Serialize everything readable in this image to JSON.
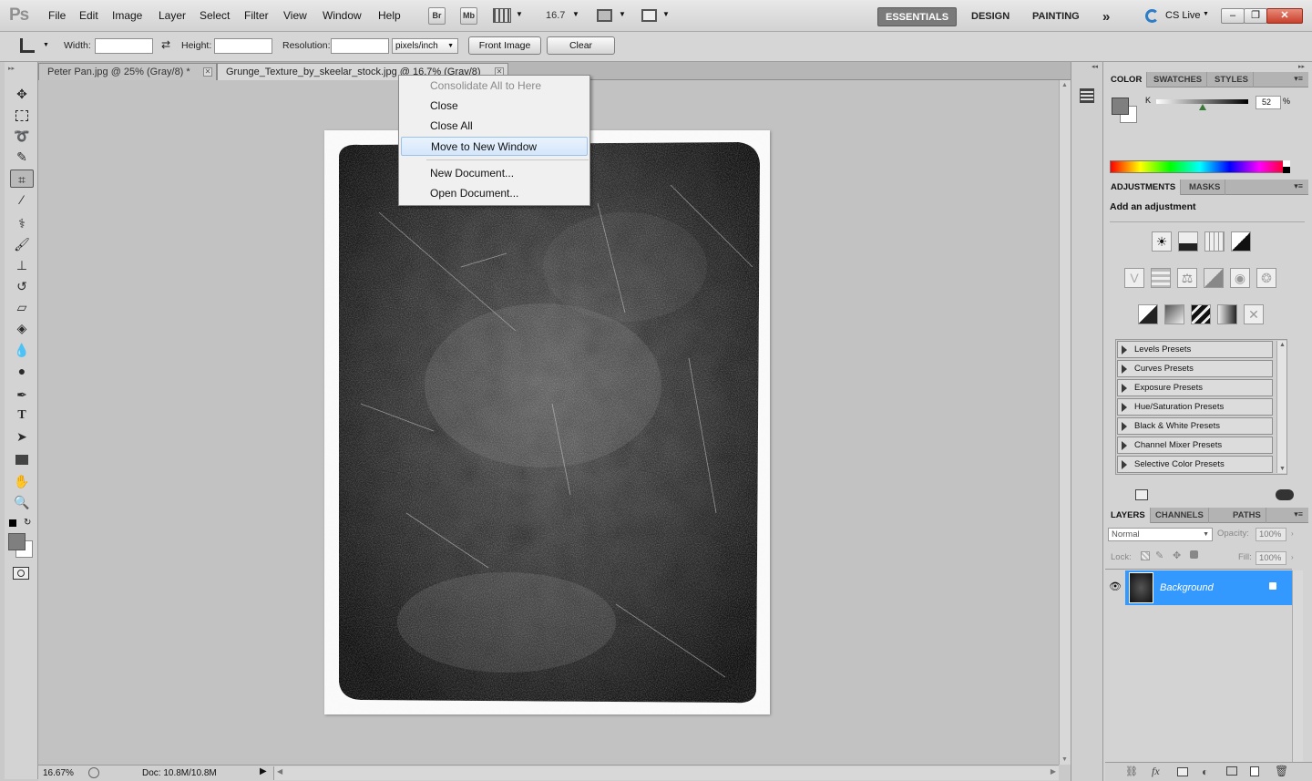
{
  "app": {
    "logo": "Ps"
  },
  "menu": [
    "File",
    "Edit",
    "Image",
    "Layer",
    "Select",
    "Filter",
    "View",
    "Window",
    "Help"
  ],
  "menubar": {
    "bridge_label": "Br",
    "minibridge_label": "Mb",
    "zoom_value": "16.7",
    "workspaces": [
      "ESSENTIALS",
      "DESIGN",
      "PAINTING"
    ],
    "more": "»",
    "cs_live": "CS Live",
    "min": "–",
    "restore": "❐",
    "close": "✕"
  },
  "options": {
    "width_label": "Width:",
    "height_label": "Height:",
    "resolution_label": "Resolution:",
    "units_value": "pixels/inch",
    "front_image": "Front Image",
    "clear": "Clear",
    "swap": "⇄"
  },
  "tabs": [
    {
      "label": "Peter Pan.jpg @ 25% (Gray/8) *",
      "close": "✕"
    },
    {
      "label": "Grunge_Texture_by_skeelar_stock.jpg @ 16.7% (Gray/8)",
      "close": "✕"
    }
  ],
  "context_menu": {
    "items": [
      {
        "label": "Consolidate All to Here",
        "disabled": true
      },
      {
        "label": "Close",
        "disabled": false
      },
      {
        "label": "Close All",
        "disabled": false
      },
      {
        "label": "Move to New Window",
        "disabled": false,
        "highlighted": true
      },
      {
        "label": "New Document...",
        "disabled": false
      },
      {
        "label": "Open Document...",
        "disabled": false
      }
    ]
  },
  "status": {
    "zoom": "16.67%",
    "doc": "Doc: 10.8M/10.8M"
  },
  "color_panel": {
    "tabs": [
      "COLOR",
      "SWATCHES",
      "STYLES"
    ],
    "channel": "K",
    "value": "52",
    "unit": "%"
  },
  "adjustments_panel": {
    "tabs": [
      "ADJUSTMENTS",
      "MASKS"
    ],
    "heading": "Add an adjustment",
    "presets": [
      "Levels Presets",
      "Curves Presets",
      "Exposure Presets",
      "Hue/Saturation Presets",
      "Black & White Presets",
      "Channel Mixer Presets",
      "Selective Color Presets"
    ]
  },
  "layers_panel": {
    "tabs": [
      "LAYERS",
      "CHANNELS",
      "PATHS"
    ],
    "blend_mode": "Normal",
    "opacity_label": "Opacity:",
    "opacity_value": "100%",
    "lock_label": "Lock:",
    "fill_label": "Fill:",
    "fill_value": "100%",
    "layer_name": "Background",
    "footer_fx": "fx"
  },
  "colors": {
    "accent_selection": "#3399ff",
    "canvas_bg": "#c2c2c2",
    "foreground": "#7f7f7f"
  }
}
